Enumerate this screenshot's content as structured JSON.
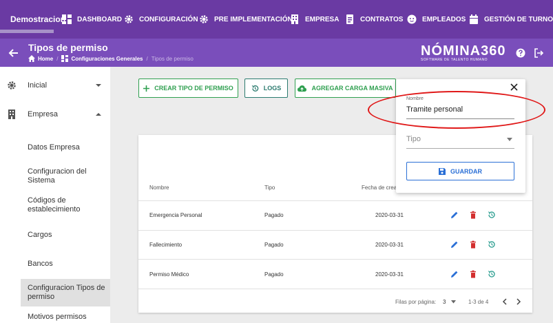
{
  "topnav": {
    "brand": "Demostracion",
    "items": [
      {
        "label": "DASHBOARD",
        "icon": "dashboard-icon"
      },
      {
        "label": "CONFIGURACIÓN",
        "icon": "gear-icon"
      },
      {
        "label": "PRE IMPLEMENTACIÓN",
        "icon": "gear-icon"
      },
      {
        "label": "EMPRESA",
        "icon": "building-icon"
      },
      {
        "label": "CONTRATOS",
        "icon": "document-icon"
      },
      {
        "label": "EMPLEADOS",
        "icon": "face-icon"
      },
      {
        "label": "GESTIÓN DE TURNOS",
        "icon": "calendar-icon"
      }
    ]
  },
  "header": {
    "title": "Tipos de permiso",
    "breadcrumb": {
      "home": "Home",
      "section": "Configuraciones Generales",
      "current": "Tipos de permiso"
    },
    "logo_main": "NÓMINA360",
    "logo_sub": "SOFTWARE DE TALENTO HUMANO"
  },
  "sidebar": {
    "inicial": "Inicial",
    "empresa": "Empresa",
    "items": [
      "Datos Empresa",
      "Configuracion del Sistema",
      "Códigos de establecimiento",
      "Cargos",
      "Bancos",
      "Configuracion Tipos de permiso",
      "Motivos permisos"
    ]
  },
  "toolbar": {
    "create": "CREAR TIPO DE PERMISO",
    "logs": "LOGS",
    "bulk": "AGREGAR CARGA MASIVA"
  },
  "table": {
    "headers": [
      "Nombre",
      "Tipo",
      "Fecha de creac"
    ],
    "rows": [
      {
        "nombre": "Emergencia Personal",
        "tipo": "Pagado",
        "fecha": "2020-03-31"
      },
      {
        "nombre": "Fallecimiento",
        "tipo": "Pagado",
        "fecha": "2020-03-31"
      },
      {
        "nombre": "Permiso Médico",
        "tipo": "Pagado",
        "fecha": "2020-03-31"
      }
    ],
    "pagination": {
      "label": "Filas por página:",
      "per_page": "3",
      "range": "1-3 de 4"
    }
  },
  "form": {
    "nombre_label": "Nombre",
    "nombre_value": "Tramite personal",
    "tipo_label": "Tipo",
    "save": "GUARDAR"
  },
  "colors": {
    "nav": "#6a3aa3",
    "subheader": "#7a4ebb",
    "green": "#2e9f4f",
    "blue": "#2a6fd6",
    "red": "#d32f2f",
    "annotation": "#e01818"
  }
}
